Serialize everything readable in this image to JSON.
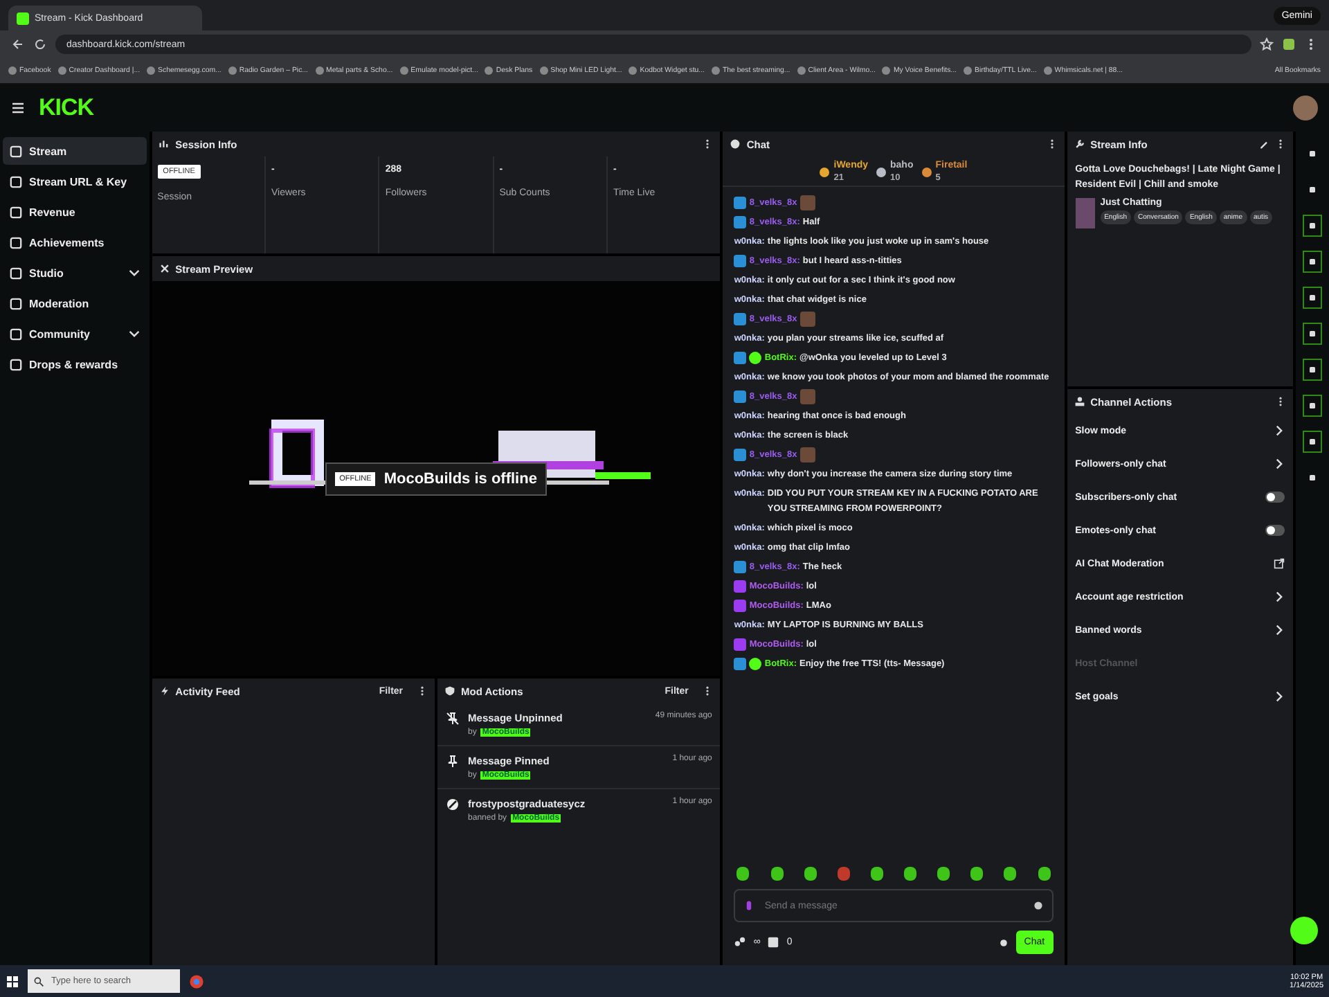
{
  "browser": {
    "tab_title": "Stream - Kick Dashboard",
    "url": "dashboard.kick.com/stream",
    "gemini": "Gemini",
    "all_bookmarks": "All Bookmarks",
    "bookmarks": [
      "Facebook",
      "Creator Dashboard |...",
      "Schemesegg.com...",
      "Radio Garden – Pic...",
      "Metal parts & Scho...",
      "Emulate model-pict...",
      "Desk Plans",
      "Shop Mini LED Light...",
      "Kodbot Widget stu...",
      "The best streaming...",
      "Client Area - Wilmo...",
      "My Voice Benefits...",
      "Birthday/TTL Live...",
      "Whimsicals.net | 88..."
    ]
  },
  "logo": "KICK",
  "sidebar": {
    "items": [
      {
        "label": "Stream",
        "selected": true,
        "expandable": false
      },
      {
        "label": "Stream URL & Key",
        "selected": false,
        "expandable": false
      },
      {
        "label": "Revenue",
        "selected": false,
        "expandable": false
      },
      {
        "label": "Achievements",
        "selected": false,
        "expandable": false
      },
      {
        "label": "Studio",
        "selected": false,
        "expandable": true
      },
      {
        "label": "Moderation",
        "selected": false,
        "expandable": false
      },
      {
        "label": "Community",
        "selected": false,
        "expandable": true
      },
      {
        "label": "Drops & rewards",
        "selected": false,
        "expandable": false
      }
    ]
  },
  "session_info": {
    "title": "Session Info",
    "stats": [
      {
        "kind": "badge",
        "value": "OFFLINE",
        "label": "Session"
      },
      {
        "kind": "number",
        "value": "-",
        "label": "Viewers"
      },
      {
        "kind": "number",
        "value": "288",
        "label": "Followers"
      },
      {
        "kind": "number",
        "value": "-",
        "label": "Sub Counts"
      },
      {
        "kind": "number",
        "value": "-",
        "label": "Time Live"
      }
    ]
  },
  "stream_preview": {
    "title": "Stream Preview",
    "badge": "OFFLINE",
    "status": "MocoBuilds is offline"
  },
  "activity_feed": {
    "title": "Activity Feed",
    "filter": "Filter"
  },
  "mod_actions": {
    "title": "Mod Actions",
    "filter": "Filter",
    "items": [
      {
        "kind": "unpin",
        "title": "Message Unpinned",
        "prefix": "by",
        "user": "MocoBuilds",
        "time": "49 minutes ago"
      },
      {
        "kind": "pin",
        "title": "Message Pinned",
        "prefix": "by",
        "user": "MocoBuilds",
        "time": "1 hour ago"
      },
      {
        "kind": "ban",
        "title": "frostypostgraduatesycz",
        "prefix": "banned by",
        "user": "MocoBuilds",
        "time": "1 hour ago"
      }
    ]
  },
  "chat": {
    "title": "Chat",
    "leaders": [
      {
        "name": "iWendy",
        "count": "21",
        "color": "#e3a72f"
      },
      {
        "name": "baho",
        "count": "10",
        "color": "#b8bcc4"
      },
      {
        "name": "Firetail",
        "count": "5",
        "color": "#d98b3a"
      }
    ],
    "messages": [
      {
        "user": "8_velks_8x",
        "color": "#9b5cf0",
        "subscriber": true,
        "verified": false,
        "broadcaster": false,
        "emote": true
      },
      {
        "user": "8_velks_8x:",
        "color": "#9b5cf0",
        "subscriber": true,
        "verified": false,
        "broadcaster": false,
        "text": "Half",
        "emote": false
      },
      {
        "user": "w0nka:",
        "color": "#cfd6ff",
        "subscriber": false,
        "verified": false,
        "broadcaster": false,
        "text": "the lights look like you just woke up in sam's house",
        "emote": false
      },
      {
        "user": "8_velks_8x:",
        "color": "#9b5cf0",
        "subscriber": true,
        "verified": false,
        "broadcaster": false,
        "text": "but I heard ass-n-titties",
        "emote": false
      },
      {
        "user": "w0nka:",
        "color": "#cfd6ff",
        "subscriber": false,
        "verified": false,
        "broadcaster": false,
        "text": "it only cut out for a sec I think it's good now",
        "emote": false
      },
      {
        "user": "w0nka:",
        "color": "#cfd6ff",
        "subscriber": false,
        "verified": false,
        "broadcaster": false,
        "text": "that chat widget is nice",
        "emote": false
      },
      {
        "user": "8_velks_8x",
        "color": "#9b5cf0",
        "subscriber": true,
        "verified": false,
        "broadcaster": false,
        "emote": true
      },
      {
        "user": "w0nka:",
        "color": "#cfd6ff",
        "subscriber": false,
        "verified": false,
        "broadcaster": false,
        "text": "you plan your streams like ice, scuffed af",
        "emote": false
      },
      {
        "user": "BotRix:",
        "color": "#53fc18",
        "subscriber": true,
        "verified": true,
        "broadcaster": false,
        "text": "@wOnka you leveled up to Level 3",
        "emote": false
      },
      {
        "user": "w0nka:",
        "color": "#cfd6ff",
        "subscriber": false,
        "verified": false,
        "broadcaster": false,
        "text": "we know you took photos of your mom and blamed the roommate",
        "emote": false
      },
      {
        "user": "8_velks_8x",
        "color": "#9b5cf0",
        "subscriber": true,
        "verified": false,
        "broadcaster": false,
        "emote": true
      },
      {
        "user": "w0nka:",
        "color": "#cfd6ff",
        "subscriber": false,
        "verified": false,
        "broadcaster": false,
        "text": "hearing that once is bad enough",
        "emote": false
      },
      {
        "user": "w0nka:",
        "color": "#cfd6ff",
        "subscriber": false,
        "verified": false,
        "broadcaster": false,
        "text": "the screen is black",
        "emote": false
      },
      {
        "user": "8_velks_8x",
        "color": "#9b5cf0",
        "subscriber": true,
        "verified": false,
        "broadcaster": false,
        "emote": true
      },
      {
        "user": "w0nka:",
        "color": "#cfd6ff",
        "subscriber": false,
        "verified": false,
        "broadcaster": false,
        "text": "why don't you increase the camera size during story time",
        "emote": false
      },
      {
        "user": "w0nka:",
        "color": "#cfd6ff",
        "subscriber": false,
        "verified": false,
        "broadcaster": false,
        "text": "DID YOU PUT YOUR STREAM KEY IN A FUCKING POTATO ARE YOU STREAMING FROM POWERPOINT?",
        "emote": false
      },
      {
        "user": "w0nka:",
        "color": "#cfd6ff",
        "subscriber": false,
        "verified": false,
        "broadcaster": false,
        "text": "which pixel is moco",
        "emote": false
      },
      {
        "user": "w0nka:",
        "color": "#cfd6ff",
        "subscriber": false,
        "verified": false,
        "broadcaster": false,
        "text": "omg that clip lmfao",
        "emote": false
      },
      {
        "user": "8_velks_8x:",
        "color": "#9b5cf0",
        "subscriber": true,
        "verified": false,
        "broadcaster": false,
        "text": "The heck",
        "emote": false
      },
      {
        "user": "MocoBuilds:",
        "color": "#b05cf0",
        "subscriber": false,
        "verified": false,
        "broadcaster": true,
        "text": "lol",
        "emote": false
      },
      {
        "user": "MocoBuilds:",
        "color": "#b05cf0",
        "subscriber": false,
        "verified": false,
        "broadcaster": true,
        "text": "LMAo",
        "emote": false
      },
      {
        "user": "w0nka:",
        "color": "#cfd6ff",
        "subscriber": false,
        "verified": false,
        "broadcaster": false,
        "text": "MY LAPTOP IS BURNING MY BALLS",
        "emote": false
      },
      {
        "user": "MocoBuilds:",
        "color": "#b05cf0",
        "subscriber": false,
        "verified": false,
        "broadcaster": true,
        "text": "lol",
        "emote": false
      },
      {
        "user": "BotRix:",
        "color": "#53fc18",
        "subscriber": true,
        "verified": true,
        "broadcaster": false,
        "text": "Enjoy the free TTS! (tts- Message)",
        "emote": false
      }
    ],
    "placeholder": "Send a message",
    "send": "Chat",
    "followers_count": "∞",
    "sub_count": "0"
  },
  "stream_info": {
    "title": "Stream Info",
    "stream_title": "Gotta Love Douchebags! | Late Night Game | Resident Evil | Chill and smoke",
    "category": "Just Chatting",
    "tags": [
      "English",
      "Conversation",
      "English",
      "anime",
      "autis"
    ]
  },
  "channel_actions": {
    "title": "Channel Actions",
    "items": [
      {
        "kind": "chevron",
        "label": "Slow mode",
        "disabled": false
      },
      {
        "kind": "chevron",
        "label": "Followers-only chat",
        "disabled": false
      },
      {
        "kind": "toggle",
        "label": "Subscribers-only chat",
        "on": false,
        "disabled": false
      },
      {
        "kind": "toggle",
        "label": "Emotes-only chat",
        "on": false,
        "disabled": false
      },
      {
        "kind": "external",
        "label": "AI Chat Moderation",
        "disabled": false
      },
      {
        "kind": "chevron",
        "label": "Account age restriction",
        "disabled": false
      },
      {
        "kind": "chevron",
        "label": "Banned words",
        "disabled": false
      },
      {
        "kind": "none",
        "label": "Host Channel",
        "disabled": true
      },
      {
        "kind": "chevron",
        "label": "Set goals",
        "disabled": false
      }
    ]
  },
  "rail": [
    {
      "highlighted": false
    },
    {
      "highlighted": false
    },
    {
      "highlighted": true
    },
    {
      "highlighted": true
    },
    {
      "highlighted": true
    },
    {
      "highlighted": true
    },
    {
      "highlighted": true
    },
    {
      "highlighted": true
    },
    {
      "highlighted": true
    },
    {
      "highlighted": false
    }
  ],
  "taskbar": {
    "search_placeholder": "Type here to search",
    "time": "10:02 PM",
    "date": "1/14/2025"
  }
}
